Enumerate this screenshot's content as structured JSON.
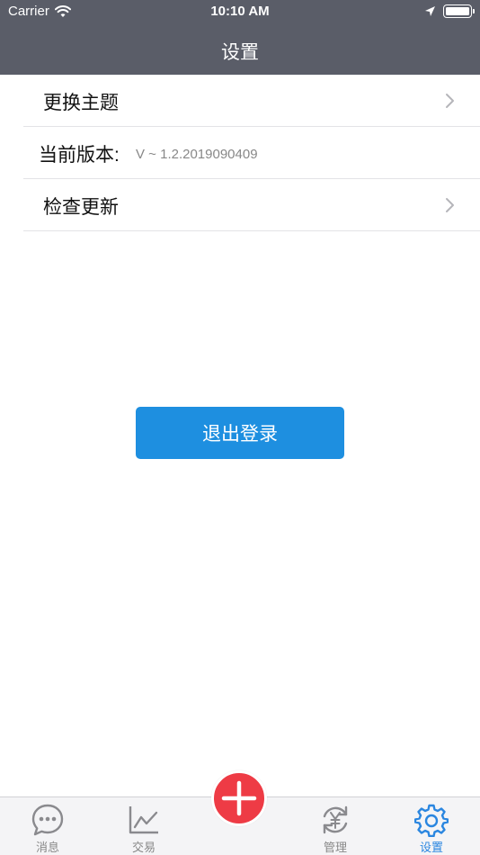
{
  "status_bar": {
    "carrier": "Carrier",
    "time": "10:10 AM",
    "icons": [
      "wifi-icon",
      "location-arrow-icon",
      "battery-icon"
    ]
  },
  "header": {
    "title": "设置"
  },
  "settings": {
    "change_theme": "更换主题",
    "version_label": "当前版本:",
    "version_value": "V ~ 1.2.2019090409",
    "check_update": "检查更新"
  },
  "logout": {
    "label": "退出登录"
  },
  "tab_bar": {
    "tabs": [
      {
        "label": "消息",
        "icon": "message-bubble-icon"
      },
      {
        "label": "交易",
        "icon": "line-chart-icon"
      },
      {
        "label": "管理",
        "icon": "yen-refresh-icon"
      },
      {
        "label": "设置",
        "icon": "gear-icon"
      }
    ],
    "fab_icon": "plus-icon",
    "active_tab": "设置"
  },
  "colors": {
    "header_bg": "#5a5d68",
    "accent": "#1e8fe0",
    "fab": "#ee3b45",
    "tab_active": "#2a86e0",
    "tab_inactive": "#888888"
  }
}
